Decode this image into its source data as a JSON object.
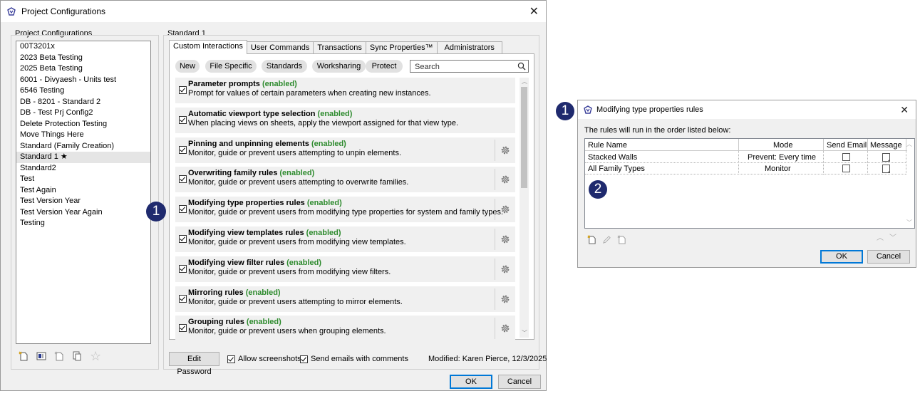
{
  "main_window": {
    "title": "Project Configurations",
    "close_label": "✕",
    "list_group_label": "Project Configurations",
    "projects": [
      "00T3201x",
      "2023 Beta Testing",
      "2025 Beta Testing",
      "6001 - Divyaesh - Units test",
      "6546 Testing",
      "DB - 8201 - Standard 2",
      "DB - Test Prj Config2",
      "Delete Protection Testing",
      "Move Things Here",
      "Standard (Family Creation)",
      "Standard 1 ★",
      "Standard2",
      "Test",
      "Test Again",
      "Test Version Year",
      "Test Version Year Again",
      "Testing"
    ],
    "selected_project_index": 10,
    "config_group_label": "Standard 1",
    "tabs": [
      "Custom Interactions",
      "User Commands",
      "Transactions",
      "Sync Properties™",
      "Administrators"
    ],
    "active_tab_index": 0,
    "filter_pills": [
      "New",
      "File Specific",
      "Standards",
      "Worksharing",
      "Protect"
    ],
    "search_placeholder": "Search",
    "rules": [
      {
        "title": "Parameter prompts",
        "status": "(enabled)",
        "desc": "Prompt for values of certain parameters when creating new instances.",
        "has_gear": false,
        "checked": true
      },
      {
        "title": "Automatic viewport type selection",
        "status": "(enabled)",
        "desc": "When placing views on sheets, apply the viewport assigned for that view type.",
        "has_gear": false,
        "checked": true
      },
      {
        "title": "Pinning and unpinning elements",
        "status": "(enabled)",
        "desc": "Monitor, guide or prevent users attempting to unpin elements.",
        "has_gear": true,
        "checked": true
      },
      {
        "title": "Overwriting family rules",
        "status": "(enabled)",
        "desc": "Monitor, guide or prevent users attempting to overwrite families.",
        "has_gear": true,
        "checked": true
      },
      {
        "title": "Modifying type properties rules",
        "status": "(enabled)",
        "desc": "Monitor, guide or prevent users from modifying type properties for system and family types.",
        "has_gear": true,
        "checked": true
      },
      {
        "title": "Modifying view templates rules",
        "status": "(enabled)",
        "desc": "Monitor, guide or prevent users from modifying view templates.",
        "has_gear": true,
        "checked": true
      },
      {
        "title": "Modifying view filter rules",
        "status": "(enabled)",
        "desc": "Monitor, guide or prevent users from modifying view filters.",
        "has_gear": true,
        "checked": true
      },
      {
        "title": "Mirroring rules",
        "status": "(enabled)",
        "desc": "Monitor, guide or prevent users attempting to mirror elements.",
        "has_gear": true,
        "checked": true
      },
      {
        "title": "Grouping rules",
        "status": "(enabled)",
        "desc": "Monitor, guide or prevent users when grouping elements.",
        "has_gear": true,
        "checked": true
      }
    ],
    "edit_password_label": "Edit Password",
    "allow_screenshots_label": "Allow screenshots",
    "send_emails_label": "Send emails with comments",
    "modified_text": "Modified: Karen Pierce, 12/3/2025",
    "ok_label": "OK",
    "cancel_label": "Cancel"
  },
  "sub_window": {
    "title": "Modifying type properties rules",
    "close_label": "✕",
    "intro": "The rules will run in the order listed below:",
    "columns": [
      "Rule Name",
      "Mode",
      "Send Email",
      "Message"
    ],
    "rows": [
      {
        "name": "Stacked Walls",
        "mode": "Prevent: Every time"
      },
      {
        "name": "All Family Types",
        "mode": "Monitor"
      }
    ],
    "ok_label": "OK",
    "cancel_label": "Cancel"
  },
  "badges": {
    "one": "1",
    "two": "2"
  },
  "colors": {
    "enabled_green": "#2e8b2e",
    "badge_navy": "#1f2a6e",
    "accent_blue": "#0078d7"
  }
}
